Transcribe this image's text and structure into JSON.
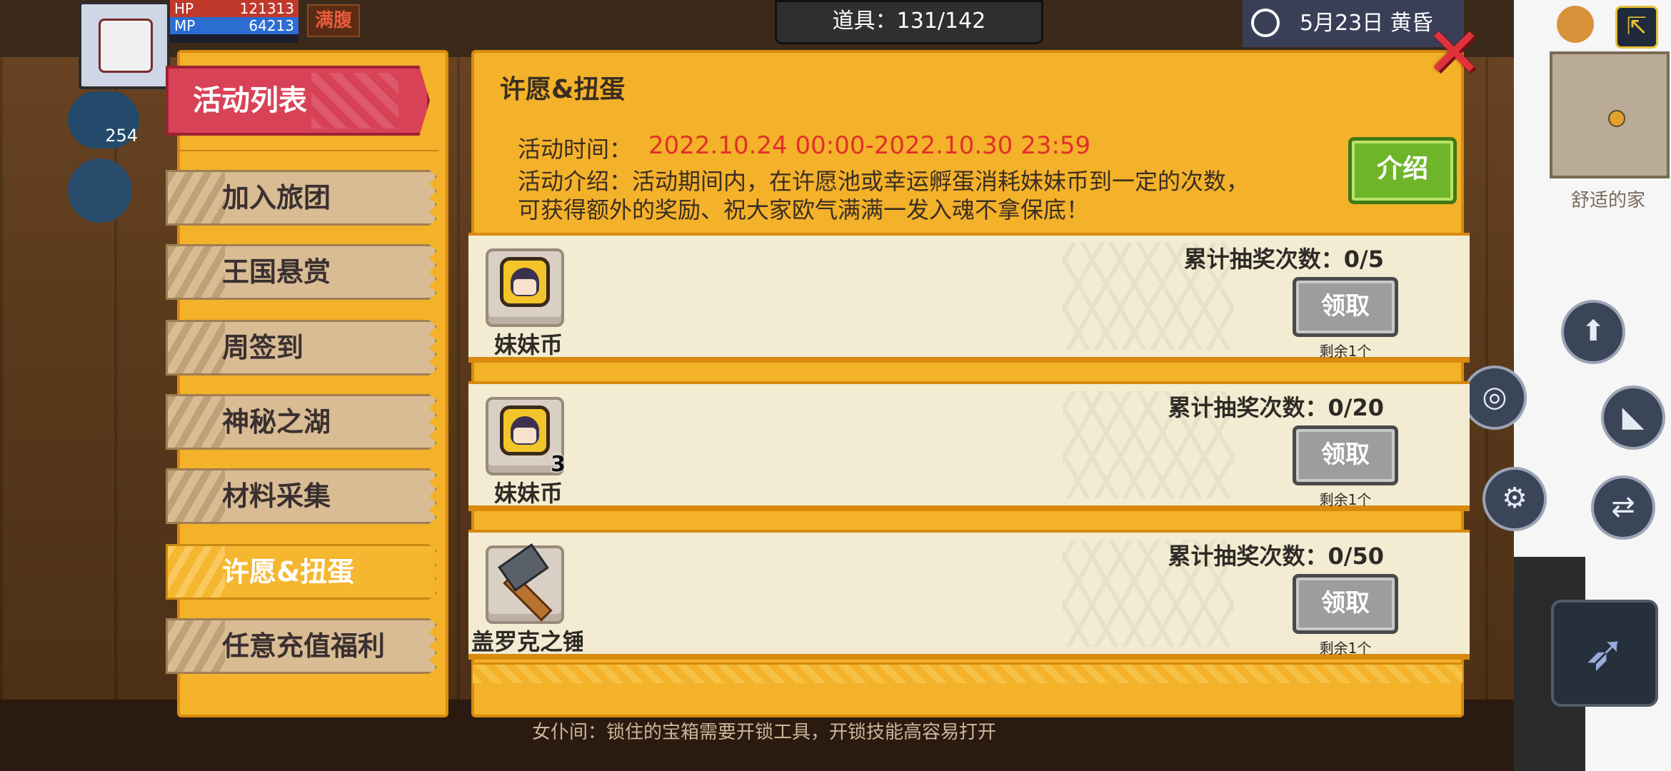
{
  "hud": {
    "hp_label": "HP",
    "hp_value": "121313",
    "mp_label": "MP",
    "mp_value": "64213",
    "full_badge": "满腹",
    "coin_count": "254",
    "items": "道具：131/142",
    "date": "5月23日 黄昏",
    "exit_icon": "exit-icon",
    "location": "舒适的家",
    "bottom_hint": "女仆间：锁住的宝箱需要开锁工具，开锁技能高容易打开"
  },
  "sidebar": {
    "title": "活动列表",
    "items": [
      {
        "label": "加入旅团"
      },
      {
        "label": "王国悬赏"
      },
      {
        "label": "周签到"
      },
      {
        "label": "神秘之湖"
      },
      {
        "label": "材料采集"
      },
      {
        "label": "许愿&扭蛋",
        "active": true
      },
      {
        "label": "任意充值福利"
      }
    ]
  },
  "panel": {
    "title": "许愿&扭蛋",
    "time_label": "活动时间：",
    "time_value": "2022.10.24 00:00-2022.10.30 23:59",
    "desc_line1": "活动介绍：活动期间内，在许愿池或幸运孵蛋消耗妹妹币到一定的次数，",
    "desc_line2": "可获得额外的奖励、祝大家欧气满满一发入魂不拿保底！",
    "intro_button": "介绍",
    "close_icon": "close-icon"
  },
  "rewards": [
    {
      "item_name": "妹妹币",
      "item_icon": "sister-coin-icon",
      "quantity": "",
      "progress": "累计抽奖次数：0/5",
      "claim": "领取",
      "remaining": "剩余1个"
    },
    {
      "item_name": "妹妹币",
      "item_icon": "sister-coin-icon",
      "quantity": "3",
      "progress": "累计抽奖次数：0/20",
      "claim": "领取",
      "remaining": "剩余1个"
    },
    {
      "item_name": "盖罗克之锤",
      "item_icon": "hammer-icon",
      "quantity": "",
      "progress": "累计抽奖次数：0/50",
      "claim": "领取",
      "remaining": "剩余1个"
    }
  ],
  "colors": {
    "panel": "#f4b12a",
    "title_tab": "#d84257",
    "time_text": "#e0302a",
    "intro_button": "#6fb52a",
    "claim_button": "#9d9d9d"
  }
}
